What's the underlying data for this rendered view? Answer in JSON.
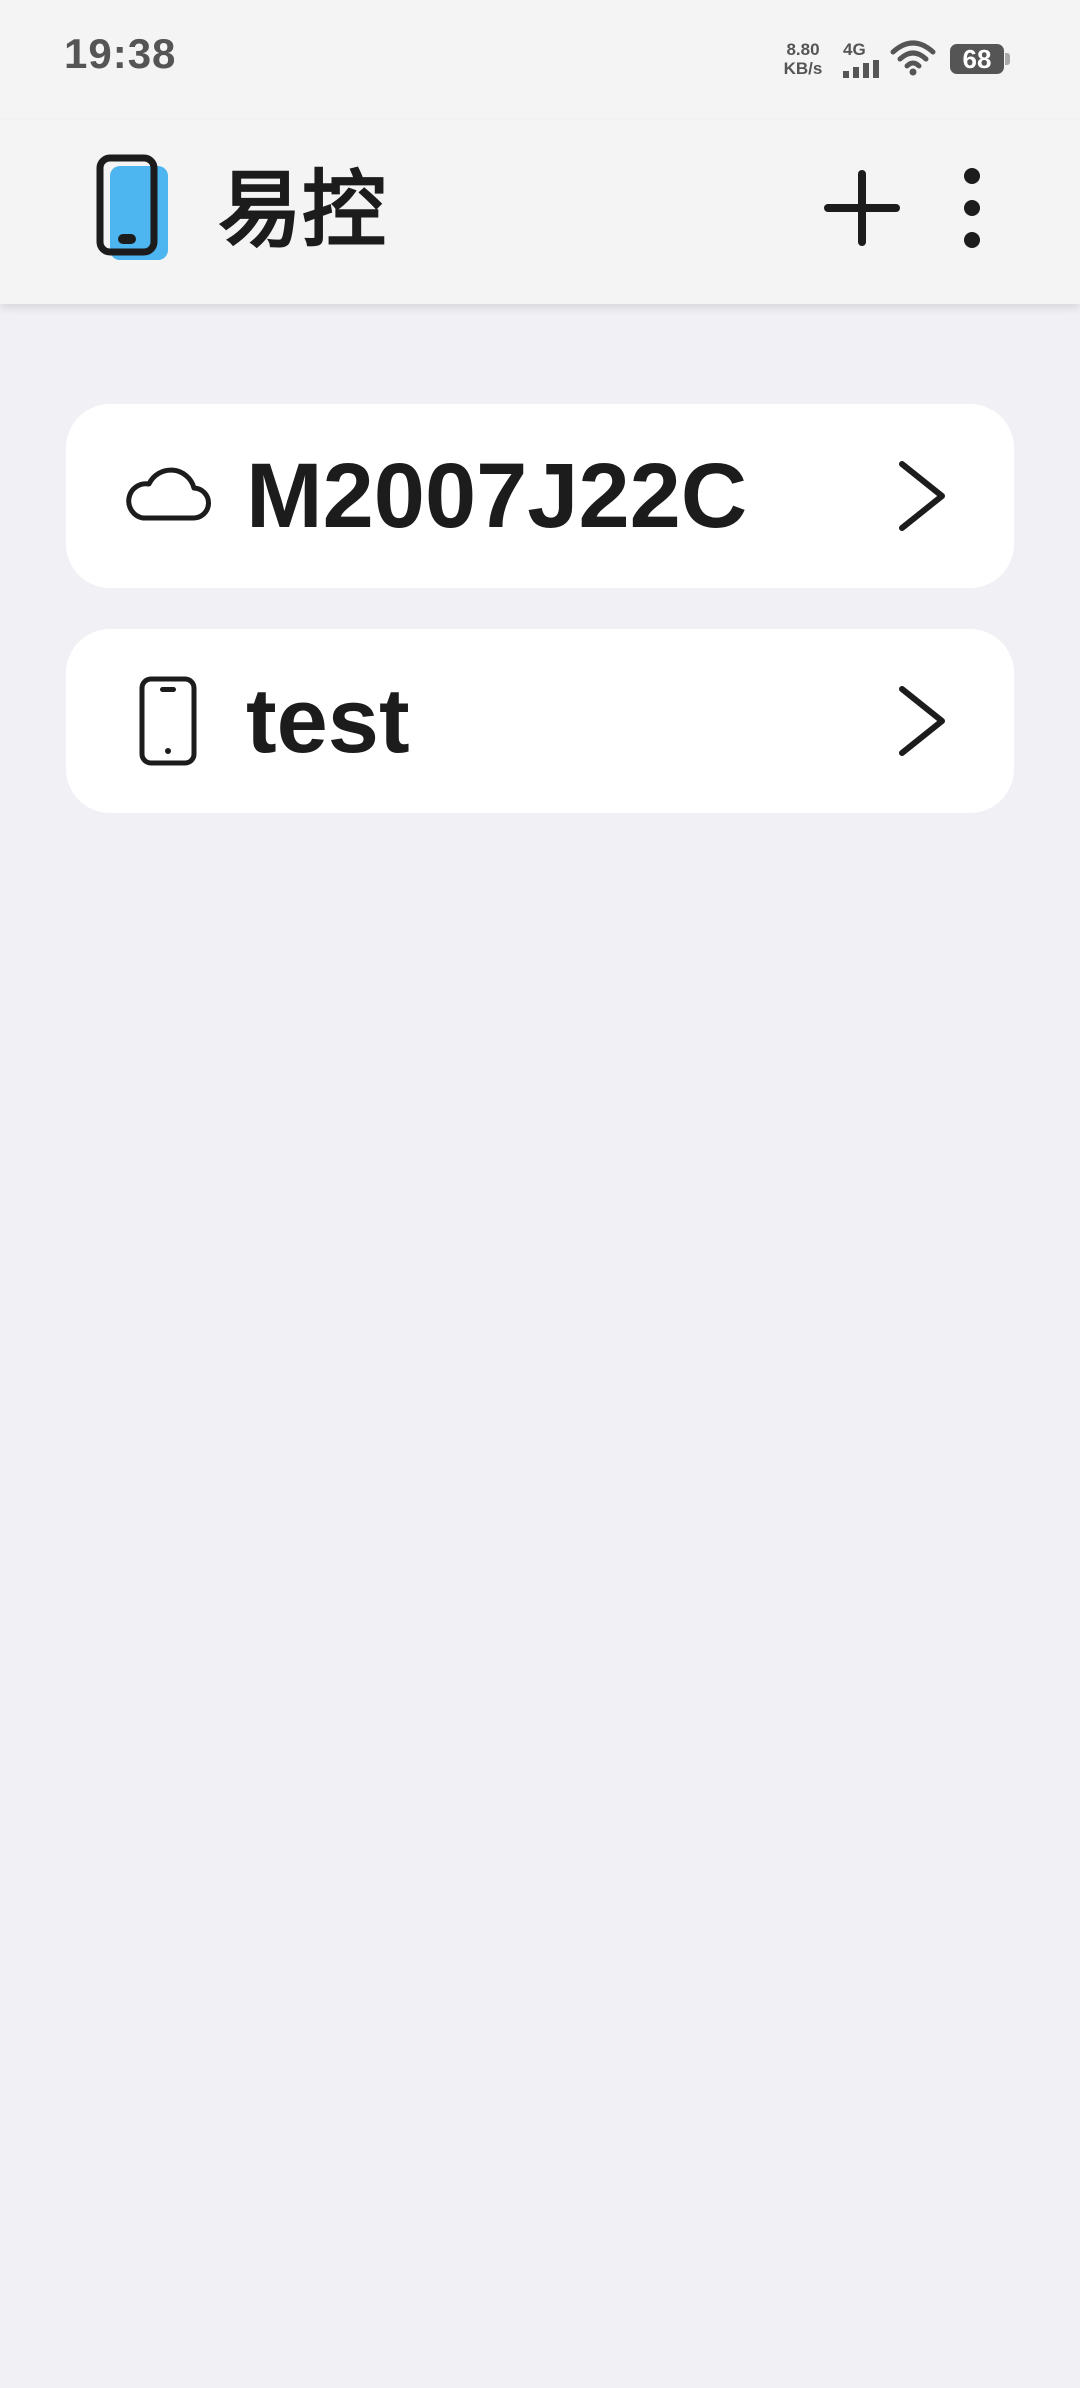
{
  "status_bar": {
    "time": "19:38",
    "net_speed_value": "8.80",
    "net_speed_unit": "KB/s",
    "signal_label": "4G",
    "battery": "68"
  },
  "app_bar": {
    "title": "易控",
    "logo_icon": "phone-logo-icon",
    "actions": [
      "plus-icon",
      "more-vertical-icon"
    ]
  },
  "devices": [
    {
      "name": "M2007J22C",
      "icon": "cloud-icon"
    },
    {
      "name": "test",
      "icon": "phone-icon"
    }
  ],
  "colors": {
    "background": "#f0f0f5",
    "app_bar": "#f4f4f4",
    "card": "#ffffff",
    "accent": "#4db6f0",
    "text": "#1c1c1c"
  }
}
